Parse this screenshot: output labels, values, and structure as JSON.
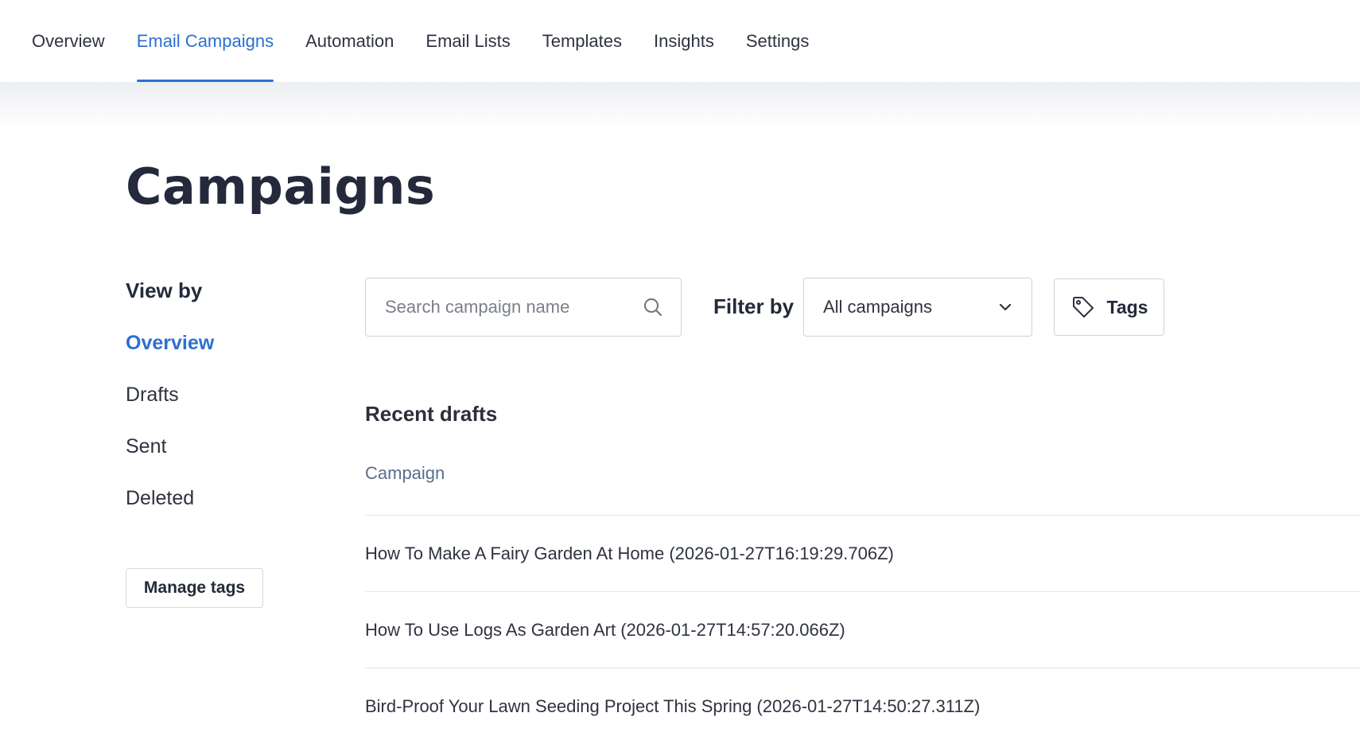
{
  "topnav": {
    "tabs": [
      {
        "label": "Overview",
        "active": false
      },
      {
        "label": "Email Campaigns",
        "active": true
      },
      {
        "label": "Automation",
        "active": false
      },
      {
        "label": "Email Lists",
        "active": false
      },
      {
        "label": "Templates",
        "active": false
      },
      {
        "label": "Insights",
        "active": false
      },
      {
        "label": "Settings",
        "active": false
      }
    ]
  },
  "page": {
    "title": "Campaigns"
  },
  "sidebar": {
    "title": "View by",
    "items": [
      {
        "label": "Overview",
        "active": true
      },
      {
        "label": "Drafts",
        "active": false
      },
      {
        "label": "Sent",
        "active": false
      },
      {
        "label": "Deleted",
        "active": false
      }
    ],
    "manage_tags_label": "Manage tags"
  },
  "toolbar": {
    "search": {
      "placeholder": "Search campaign name",
      "value": "",
      "icon": "search-icon"
    },
    "filter_label": "Filter by",
    "filter_value": "All campaigns",
    "filter_icon": "chevron-down-icon",
    "tags_label": "Tags",
    "tags_icon": "tag-icon"
  },
  "drafts": {
    "title": "Recent drafts",
    "column_header": "Campaign",
    "rows": [
      {
        "name": "How To Make A Fairy Garden At Home (2026-01-27T16:19:29.706Z)"
      },
      {
        "name": "How To Use Logs As Garden Art (2026-01-27T14:57:20.066Z)"
      },
      {
        "name": "Bird-Proof Your Lawn Seeding Project This Spring (2026-01-27T14:50:27.311Z)"
      }
    ]
  },
  "colors": {
    "accent": "#2d6fd2",
    "heading": "#242a3b",
    "border": "#cfd3d9"
  }
}
